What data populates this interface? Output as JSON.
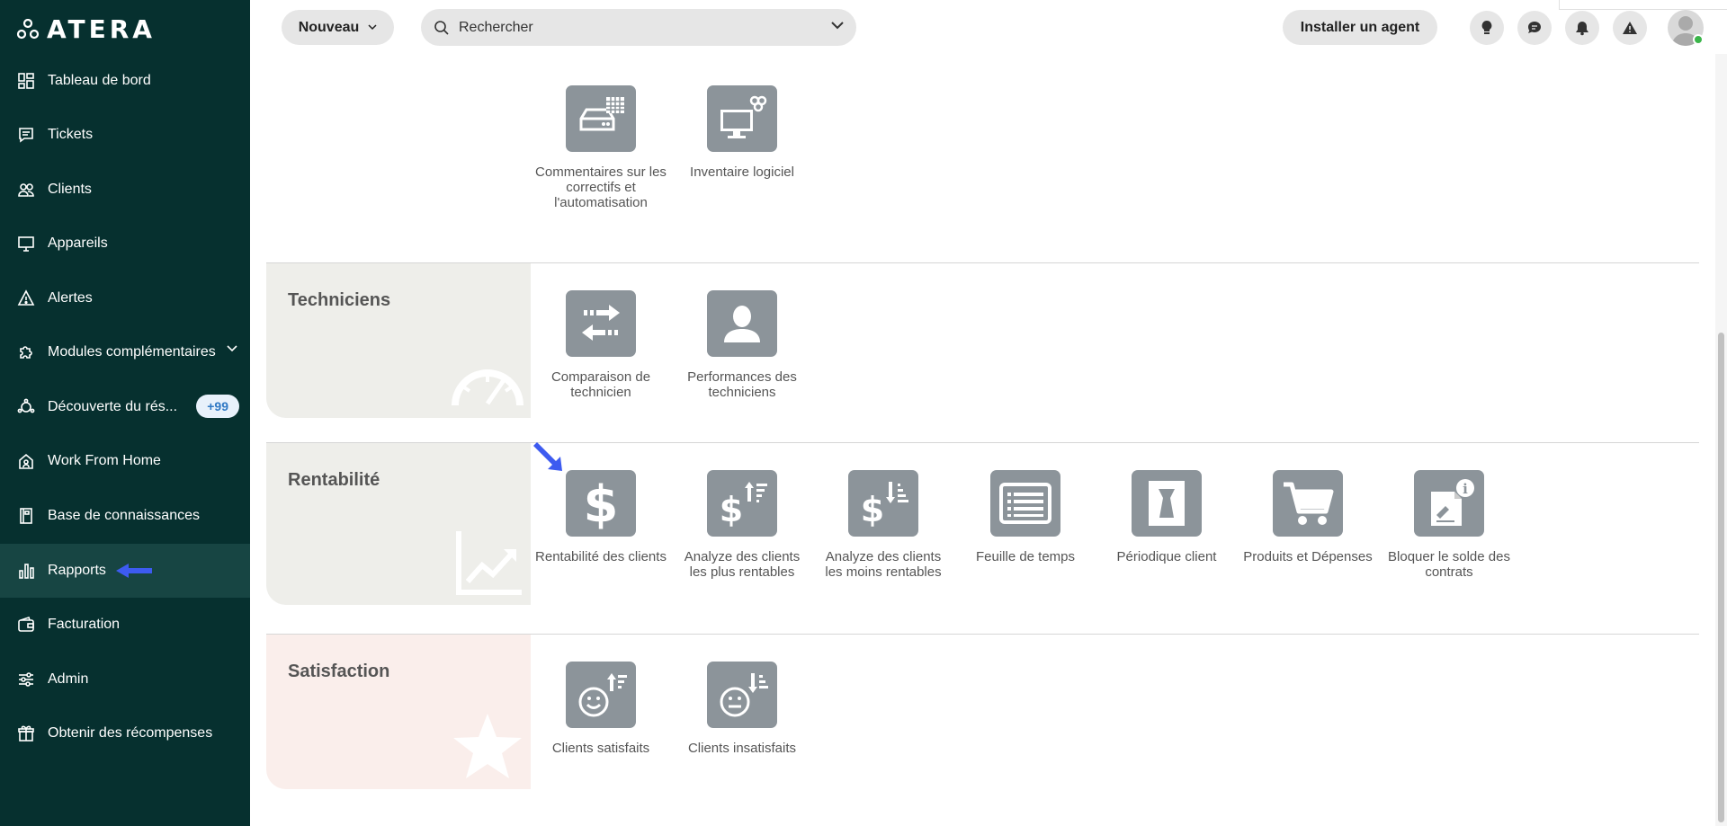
{
  "app": {
    "logo_text": "ATERA"
  },
  "sidebar": {
    "items": [
      {
        "label": "Tableau de bord",
        "icon": "dashboard-icon"
      },
      {
        "label": "Tickets",
        "icon": "ticket-icon"
      },
      {
        "label": "Clients",
        "icon": "clients-icon"
      },
      {
        "label": "Appareils",
        "icon": "monitor-icon"
      },
      {
        "label": "Alertes",
        "icon": "warning-icon"
      },
      {
        "label": "Modules complémentaires",
        "icon": "puzzle-icon"
      },
      {
        "label": "Découverte du rés...",
        "icon": "network-icon",
        "badge": "+99"
      },
      {
        "label": "Work From Home",
        "icon": "home-icon"
      },
      {
        "label": "Base de connaissances",
        "icon": "book-icon"
      },
      {
        "label": "Rapports",
        "icon": "bar-chart-icon",
        "active": true
      },
      {
        "label": "Facturation",
        "icon": "wallet-icon"
      },
      {
        "label": "Admin",
        "icon": "sliders-icon"
      },
      {
        "label": "Obtenir des récompenses",
        "icon": "gift-icon"
      }
    ]
  },
  "header": {
    "new_label": "Nouveau",
    "search_placeholder": "Rechercher",
    "install_agent_label": "Installer un agent",
    "icons": [
      "lightbulb-icon",
      "chat-icon",
      "bell-icon",
      "alert-icon"
    ]
  },
  "sections": {
    "top": {
      "tiles": [
        {
          "label": "Commentaires sur les correctifs et l'automatisation",
          "icon": "patch-feedback-icon"
        },
        {
          "label": "Inventaire logiciel",
          "icon": "software-inventory-icon"
        }
      ]
    },
    "techniciens": {
      "title": "Techniciens",
      "tiles": [
        {
          "label": "Comparaison de technicien",
          "icon": "compare-arrows-icon"
        },
        {
          "label": "Performances des techniciens",
          "icon": "person-icon"
        }
      ]
    },
    "rentabilite": {
      "title": "Rentabilité",
      "tiles": [
        {
          "label": "Rentabilité des clients",
          "icon": "dollar-icon"
        },
        {
          "label": "Analyze des clients les plus rentables",
          "icon": "dollar-sort-up-icon"
        },
        {
          "label": "Analyze des clients les moins rentables",
          "icon": "dollar-sort-down-icon"
        },
        {
          "label": "Feuille de temps",
          "icon": "timesheet-icon"
        },
        {
          "label": "Périodique client",
          "icon": "periodic-client-icon"
        },
        {
          "label": "Produits et Dépenses",
          "icon": "cart-icon"
        },
        {
          "label": "Bloquer le solde des contrats",
          "icon": "contract-info-icon"
        }
      ]
    },
    "satisfaction": {
      "title": "Satisfaction",
      "tiles": [
        {
          "label": "Clients satisfaits",
          "icon": "happy-face-icon"
        },
        {
          "label": "Clients insatisfaits",
          "icon": "neutral-face-icon"
        }
      ]
    }
  },
  "colors": {
    "sidebar_bg": "#06302f",
    "sidebar_active": "#174543",
    "tile_bg": "#8c949a",
    "panel_neutral": "#eeeeea",
    "panel_satisfaction": "#faeeeb",
    "arrow_blue": "#3d5bf0"
  }
}
